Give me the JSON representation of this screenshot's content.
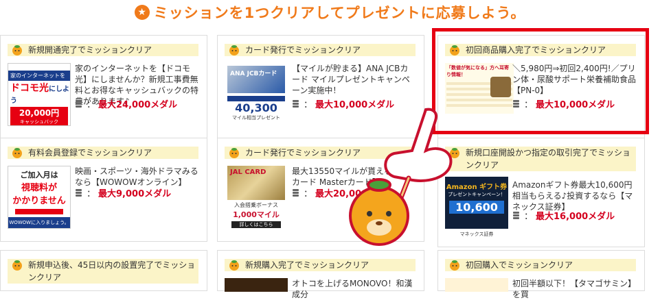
{
  "header": {
    "title": "ミッションを1つクリアしてプレゼントに応募しよう。",
    "icon": "star-icon"
  },
  "colors": {
    "accent": "#f07a1a",
    "reward": "#d4001e",
    "highlight": "#e60012",
    "tag_bg": "#fbf4c8"
  },
  "cards": [
    {
      "tag": "新規開通完了でミッションクリア",
      "desc": "家のインターネットを【ドコモ光】にしませんか？新規工事費無料とお得なキャッシュバックの特典があります♪",
      "reward_label": "：",
      "reward": "最大24,000メダル",
      "thumb": {
        "line1": "家のインターネットを",
        "line2": "ドコモ光",
        "line3": "にしよう",
        "line4": "20,000円",
        "line5": "キャッシュバック",
        "line6": "0円"
      }
    },
    {
      "tag": "カード発行でミッションクリア",
      "desc": "【マイルが貯まる】ANA JCBカード マイルプレゼントキャンペーン実施中！",
      "reward_label": "：",
      "reward": "最大10,000メダル",
      "thumb": {
        "line1": "ANA JCBカード",
        "line2": "40,300",
        "line3": "マイル相当プレゼント"
      }
    },
    {
      "tag": "初回商品購入完了でミッションクリア",
      "desc": "＼5,980円⇒初回2,400円!／プリン体・尿酸サポート栄養補助食品【PN-0】",
      "reward_label": "：",
      "reward": "最大10,000メダル",
      "thumb": {
        "line1": "「数値が気になる」方へ耳寄り情報！"
      }
    },
    {
      "tag": "有料会員登録でミッションクリア",
      "desc": "映画・スポーツ・海外ドラマみるなら【WOWOWオンライン】",
      "reward_label": "：",
      "reward": "最大9,000メダル",
      "thumb": {
        "line1": "ご加入月は",
        "line2": "視聴料が",
        "line3": "かかりません",
        "line4": "WOWOWに入りましょう。"
      }
    },
    {
      "tag": "カード発行でミッションクリア",
      "desc": "最大13550マイルが貰える　JALカード Masterカード】",
      "reward_label": "：",
      "reward": "最大20,000メダル",
      "thumb": {
        "line1": "JAL CARD",
        "line2": "入会搭乗ボーナス",
        "line3": "1,000マイル",
        "line4": "詳しくはこちら"
      }
    },
    {
      "tag": "新規口座開設かつ指定の取引完了でミッションクリア",
      "desc": "Amazonギフト券最大10,600円相当もらえる♪投資するなら【マネックス証券】",
      "reward_label": "：",
      "reward": "最大16,000メダル",
      "thumb": {
        "line1": "Amazon ギフト券",
        "line2": "プレゼントキャンペーン！",
        "line3": "10,600",
        "line4": "マネックス証券"
      }
    },
    {
      "tag": "新規申込後、45日以内の設置完了でミッションクリア"
    },
    {
      "tag": "新規購入完了でミッションクリア",
      "desc": "オトコを上げるMONOVO！和漢成分"
    },
    {
      "tag": "初回購入でミッションクリア",
      "desc": "初回半額以下！【タマゴサミン】を買"
    }
  ]
}
